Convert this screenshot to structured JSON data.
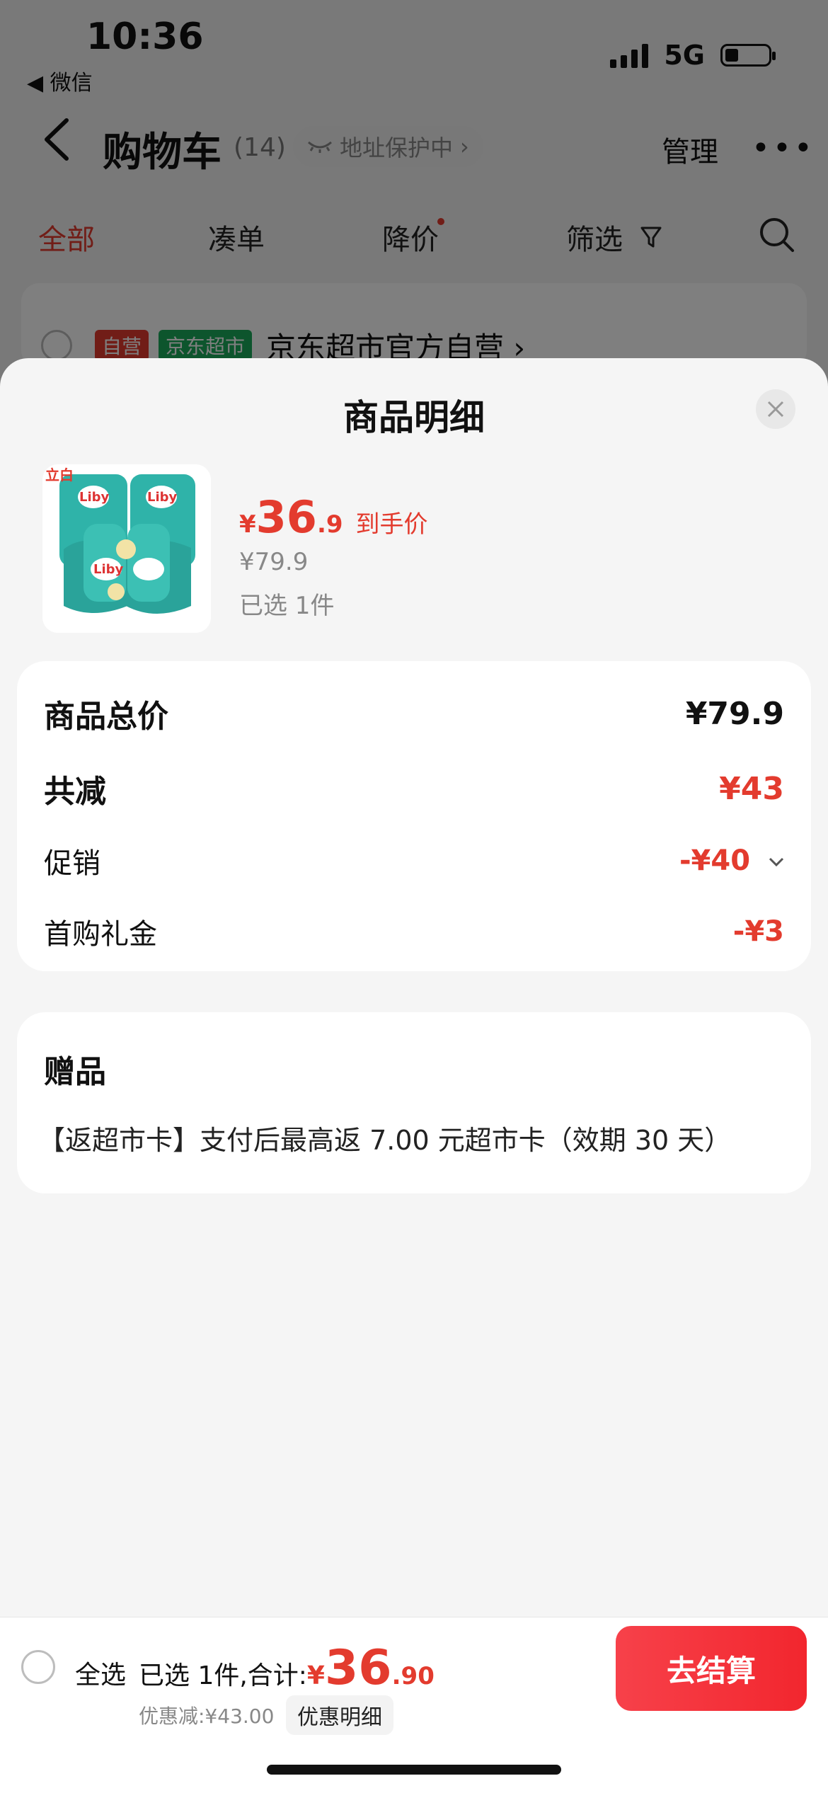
{
  "status_bar": {
    "time": "10:36",
    "back_app": "◀ 微信",
    "network": "5G",
    "signal_bars": 4,
    "battery_level": 0.3
  },
  "nav": {
    "title": "购物车",
    "count": "(14)",
    "address_protect": "地址保护中",
    "manage": "管理"
  },
  "tabs": [
    {
      "label": "全部",
      "active": true
    },
    {
      "label": "凑单"
    },
    {
      "label": "降价",
      "has_dot": true
    },
    {
      "label": "筛选"
    }
  ],
  "store": {
    "tag_self": "自营",
    "tag_market": "京东超市",
    "name": "京东超市官方自营"
  },
  "sheet": {
    "title": "商品明细",
    "product": {
      "price_symbol": "¥",
      "price_int": "36",
      "price_dec": ".9",
      "price_label": "到手价",
      "original_price": "¥79.9",
      "selected_qty": "已选 1件",
      "brand": "Liby",
      "badge": "立白"
    },
    "price_detail": {
      "total_label": "商品总价",
      "total_value": "¥79.9",
      "reduce_label": "共减",
      "reduce_value": "¥43",
      "promo_label": "促销",
      "promo_value": "-¥40",
      "first_gift_label": "首购礼金",
      "first_gift_value": "-¥3"
    },
    "gift": {
      "title": "赠品",
      "text": "【返超市卡】支付后最高返 7.00 元超市卡（效期 30 天）"
    }
  },
  "footer": {
    "select_all": "全选",
    "summary_prefix": "已选 1件,合计:",
    "price_symbol": "¥",
    "price_int": "36",
    "price_dec": ".90",
    "discount": "优惠减:¥43.00",
    "discount_detail": "优惠明细",
    "checkout": "去结算"
  },
  "colors": {
    "accent": "#e33b2e",
    "market_green": "#1aab5b",
    "checkout": "#f2262e"
  },
  "icons": [
    "back-icon",
    "chevron-right-icon",
    "eye-closed-icon",
    "more-icon",
    "filter-icon",
    "search-icon",
    "close-icon",
    "chevron-down-icon"
  ]
}
